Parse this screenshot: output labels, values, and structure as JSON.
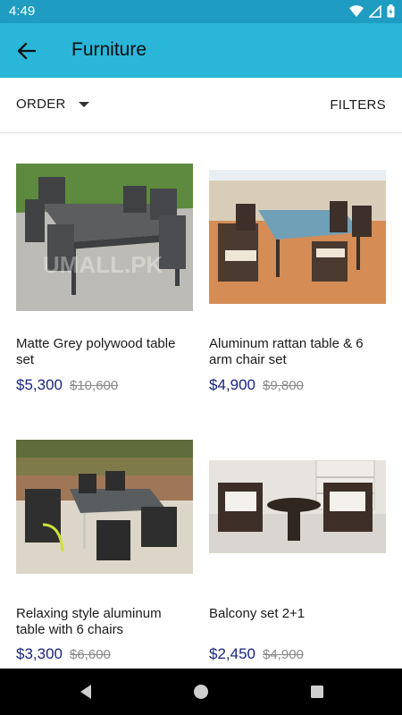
{
  "status": {
    "time": "4:49"
  },
  "header": {
    "title": "Furniture"
  },
  "toolbar": {
    "order_label": "ORDER",
    "filters_label": "FILTERS"
  },
  "products": [
    {
      "name": "Matte Grey polywood table set",
      "price": "$5,300",
      "old_price": "$10,600"
    },
    {
      "name": "Aluminum rattan table & 6 arm chair set",
      "price": "$4,900",
      "old_price": "$9,800"
    },
    {
      "name": "Relaxing style aluminum table with 6 chairs",
      "price": "$3,300",
      "old_price": "$6,600"
    },
    {
      "name": "Balcony set 2+1",
      "price": "$2,450",
      "old_price": "$4,900"
    }
  ],
  "colors": {
    "status_bar": "#1e9cc2",
    "app_bar": "#29b6d9",
    "price": "#1a237e"
  }
}
